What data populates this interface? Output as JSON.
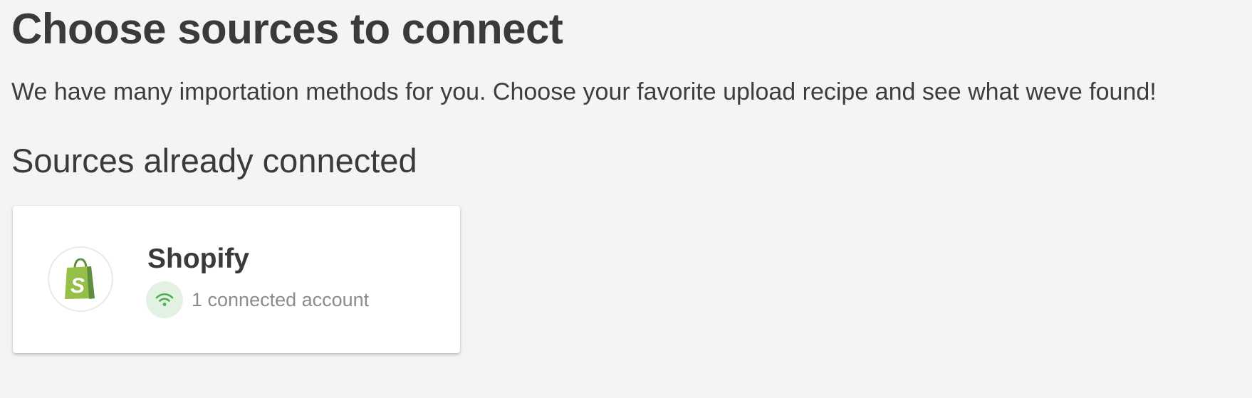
{
  "page": {
    "title": "Choose sources to connect",
    "subtitle": "We have many importation methods for you. Choose your favorite upload recipe and see what weve found!"
  },
  "connected_section": {
    "title": "Sources already connected",
    "sources": [
      {
        "name": "Shopify",
        "logo_icon": "shopify-bag-icon",
        "status_icon": "wifi-icon",
        "status_text": "1 connected account"
      }
    ]
  },
  "colors": {
    "background": "#f4f4f4",
    "card_background": "#ffffff",
    "text_primary": "#3a3a3a",
    "text_muted": "#8c8c8c",
    "shopify_green": "#95bf47",
    "shopify_dark_green": "#5e8e3e",
    "status_bg": "#e2f1e2",
    "status_icon": "#4cae4c"
  }
}
